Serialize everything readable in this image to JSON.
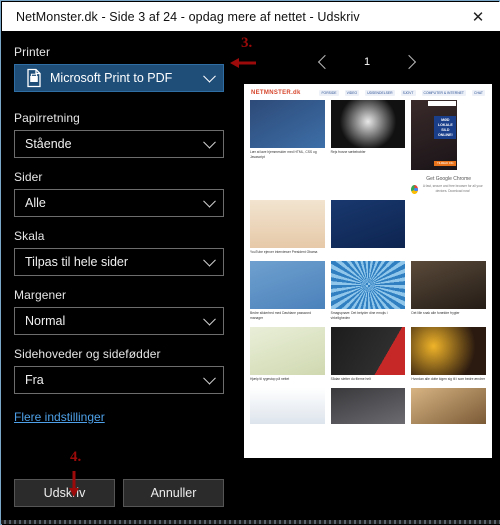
{
  "window": {
    "title": "NetMonster.dk - Side 3 af 24 - opdag mere af nettet - Udskriv",
    "close_icon": "✕"
  },
  "panel": {
    "printer": {
      "label": "Printer",
      "value": "Microsoft Print to PDF",
      "icon": "printer-document-icon"
    },
    "orientation": {
      "label": "Papirretning",
      "value": "Stående"
    },
    "pages": {
      "label": "Sider",
      "value": "Alle"
    },
    "scale": {
      "label": "Skala",
      "value": "Tilpas til hele sider"
    },
    "margins": {
      "label": "Margener",
      "value": "Normal"
    },
    "headers": {
      "label": "Sidehoveder og sidefødder",
      "value": "Fra"
    },
    "more_settings_link": "Flere indstillinger",
    "print_button": "Udskriv",
    "cancel_button": "Annuller"
  },
  "preview": {
    "prev_icon": "chevron-left-icon",
    "next_icon": "chevron-right-icon",
    "page_number": "1",
    "site": {
      "logo_a": "NET",
      "logo_b": "M",
      "logo_c": "NSTER",
      "logo_suffix": ".dk",
      "nav": [
        "FORSIDE",
        "VIDEO",
        "UDSENDELSER",
        "SJOVT",
        "COMPUTER & INTERNET",
        "CHAT"
      ],
      "cards": [
        {
          "caption": "Lær at lave hjemmesider med HTML, CSS og Javascript"
        },
        {
          "caption": "Rejs frosne sæbebobler"
        },
        {
          "caption": "YouTube ejercer interviewer President Obama"
        },
        {
          "caption": "Bedre sikkerhed med Dashlane password manager"
        },
        {
          "caption": "Smagsprøve: Det betyder dine emojis i virkeligheden"
        },
        {
          "caption": "Det lille snak alle forældre frygter"
        },
        {
          "caption": "Hjælp til rygestop på nettet"
        },
        {
          "caption": "Sådan sletter du filerne helt"
        },
        {
          "caption": "Hvordan alle dotte kigen sig til i som bedre ændrer"
        },
        {
          "caption": ""
        },
        {
          "caption": ""
        },
        {
          "caption": ""
        }
      ],
      "ad": {
        "line1": "MØD",
        "line2": "LOKALE",
        "line3": "SILD",
        "line4": "ONLINE!",
        "button": "TILMELD DIG"
      },
      "chrome_ad": {
        "title": "Get Google Chrome",
        "body": "A fast, secure and free browser for all your devices. Download now!"
      }
    }
  },
  "annotations": {
    "step3": "3.",
    "step4": "4.",
    "arrow_left_icon": "red-arrow-left-icon",
    "arrow_down_icon": "red-arrow-down-icon"
  },
  "colors": {
    "accent": "#1f4e79",
    "link": "#4ea1e8",
    "annotation": "#9c0a0a",
    "frame": "#7aa7c7"
  }
}
